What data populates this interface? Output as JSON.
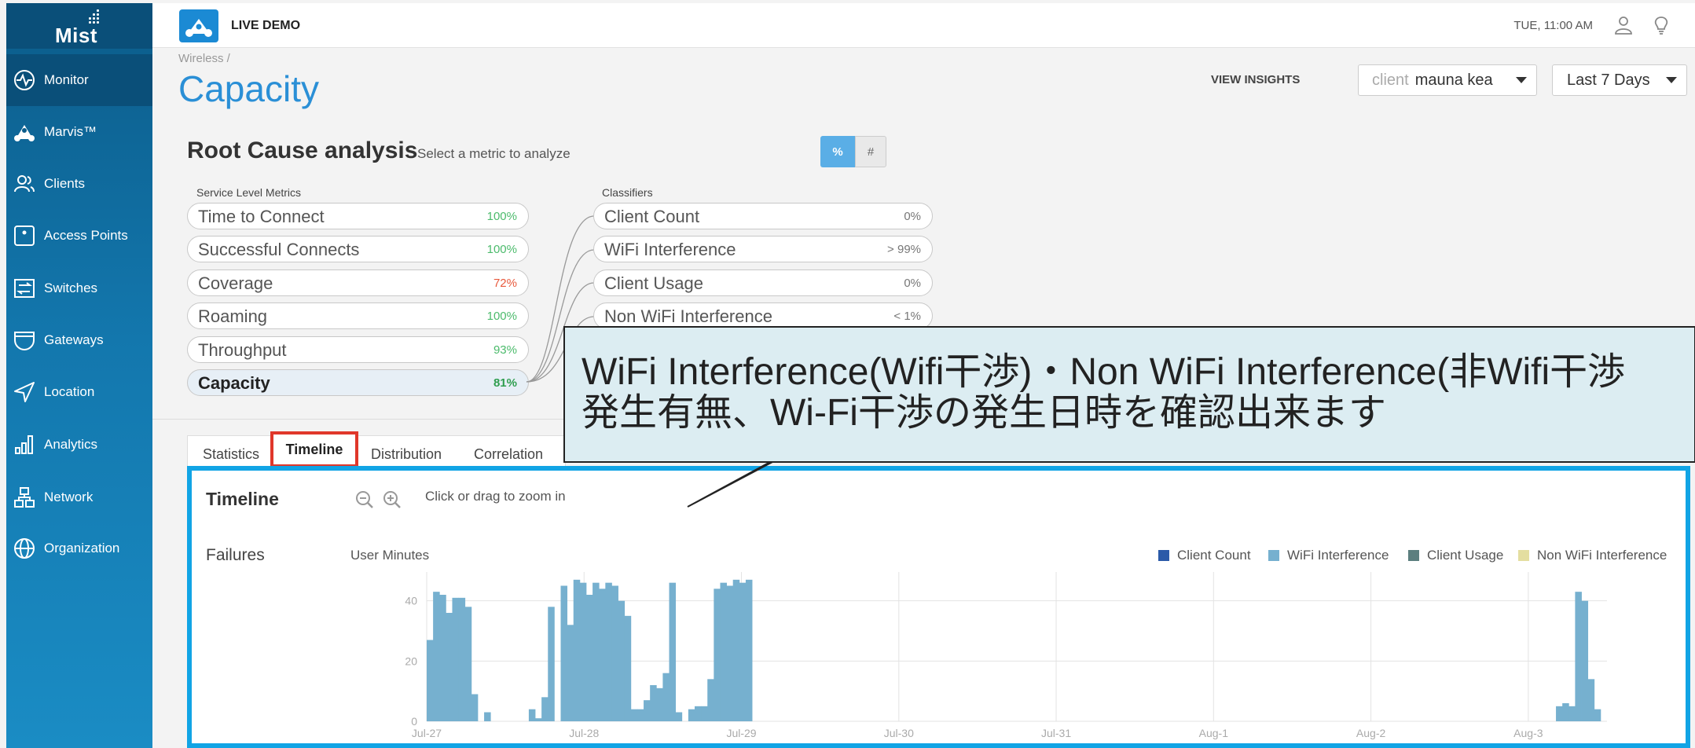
{
  "sidebar": {
    "logo": "Mist",
    "items": [
      {
        "label": "Monitor",
        "icon": "monitor-icon"
      },
      {
        "label": "Marvis™",
        "icon": "marvis-icon"
      },
      {
        "label": "Clients",
        "icon": "clients-icon"
      },
      {
        "label": "Access Points",
        "icon": "access-point-icon"
      },
      {
        "label": "Switches",
        "icon": "switch-icon"
      },
      {
        "label": "Gateways",
        "icon": "gateway-icon"
      },
      {
        "label": "Location",
        "icon": "location-icon"
      },
      {
        "label": "Analytics",
        "icon": "analytics-icon"
      },
      {
        "label": "Network",
        "icon": "network-icon"
      },
      {
        "label": "Organization",
        "icon": "globe-icon"
      }
    ]
  },
  "topbar": {
    "demo_label": "LIVE DEMO",
    "clock": "TUE, 11:00 AM"
  },
  "header": {
    "breadcrumb": "Wireless /",
    "title": "Capacity",
    "view_insights": "VIEW INSIGHTS",
    "client_prefix": "client",
    "client_value": "mauna kea",
    "range": "Last 7 Days"
  },
  "rca": {
    "title": "Root Cause analysis",
    "subtitle": "Select a metric to analyze",
    "toggle_pct": "%",
    "toggle_num": "#",
    "slm_header": "Service Level Metrics",
    "classifiers_header": "Classifiers",
    "metrics": [
      {
        "name": "Time to Connect",
        "value": "100%",
        "color": "#4cbb6c"
      },
      {
        "name": "Successful Connects",
        "value": "100%",
        "color": "#4cbb6c"
      },
      {
        "name": "Coverage",
        "value": "72%",
        "color": "#e8593c"
      },
      {
        "name": "Roaming",
        "value": "100%",
        "color": "#4cbb6c"
      },
      {
        "name": "Throughput",
        "value": "93%",
        "color": "#4cbb6c"
      },
      {
        "name": "Capacity",
        "value": "81%",
        "color": "#2f9e4f"
      }
    ],
    "classifiers": [
      {
        "name": "Client Count",
        "value": "0%"
      },
      {
        "name": "WiFi Interference",
        "value": "> 99%"
      },
      {
        "name": "Client Usage",
        "value": "0%"
      },
      {
        "name": "Non WiFi Interference",
        "value": "< 1%"
      }
    ]
  },
  "callout": {
    "line1": "WiFi Interference(Wifi干渉)・Non WiFi Interference(非Wifi干渉",
    "line2": "発生有無、Wi-Fi干渉の発生日時を確認出来ます"
  },
  "tabs": [
    "Statistics",
    "Timeline",
    "Distribution",
    "Correlation"
  ],
  "timeline": {
    "title": "Timeline",
    "zoom_hint": "Click or drag to zoom in",
    "failures_label": "Failures",
    "y_label": "User Minutes"
  },
  "chart_data": {
    "type": "bar",
    "ylabel": "User Minutes",
    "ylim": [
      0,
      48
    ],
    "yticks": [
      0,
      20,
      40
    ],
    "xticks": [
      "Jul-27",
      "Jul-28",
      "Jul-29",
      "Jul-30",
      "Jul-31",
      "Aug-1",
      "Aug-2",
      "Aug-3"
    ],
    "colors": {
      "Client Count": "#2b5aa8",
      "WiFi Interference": "#76b0cf",
      "Client Usage": "#5c7f7f",
      "Non WiFi Interference": "#e4dea0"
    },
    "legend": [
      "Client Count",
      "WiFi Interference",
      "Client Usage",
      "Non WiFi Interference"
    ],
    "series": [
      {
        "name": "WiFi Interference",
        "values": [
          27,
          43,
          42,
          36,
          41,
          41,
          38,
          9,
          0,
          3,
          0,
          0,
          0,
          0,
          0,
          0,
          4,
          1,
          8,
          38,
          0,
          45,
          32,
          47,
          46,
          42,
          46,
          44,
          46,
          45,
          40,
          35,
          4,
          4,
          7,
          12,
          11,
          16,
          46,
          3,
          0,
          4,
          5,
          5,
          14,
          44,
          46,
          45,
          47,
          46,
          47,
          0,
          0,
          0,
          0,
          0,
          0,
          0,
          0,
          0,
          0,
          0,
          0,
          0,
          0,
          0,
          0,
          0,
          0,
          0,
          0,
          0,
          0,
          0,
          0,
          0,
          0,
          0,
          0,
          0,
          0,
          0,
          0,
          0,
          0,
          0,
          0,
          0,
          0,
          0,
          0,
          0,
          0,
          0,
          0,
          0,
          0,
          0,
          0,
          0,
          0,
          0,
          0,
          0,
          0,
          0,
          0,
          0,
          0,
          0,
          0,
          0,
          0,
          0,
          0,
          0,
          0,
          0,
          0,
          0,
          0,
          0,
          0,
          0,
          0,
          0,
          0,
          0,
          0,
          0,
          0,
          0,
          0,
          0,
          0,
          0,
          0,
          0,
          0,
          0,
          0,
          0,
          0,
          0,
          0,
          0,
          0,
          0,
          0,
          0,
          0,
          0,
          0,
          0,
          0,
          0,
          0,
          0,
          0,
          0,
          0,
          0,
          0,
          0,
          0,
          0,
          0,
          0,
          0,
          0,
          0,
          0,
          0,
          0,
          0,
          0,
          0,
          5,
          6,
          5,
          43,
          40,
          14,
          4,
          0
        ]
      }
    ]
  }
}
